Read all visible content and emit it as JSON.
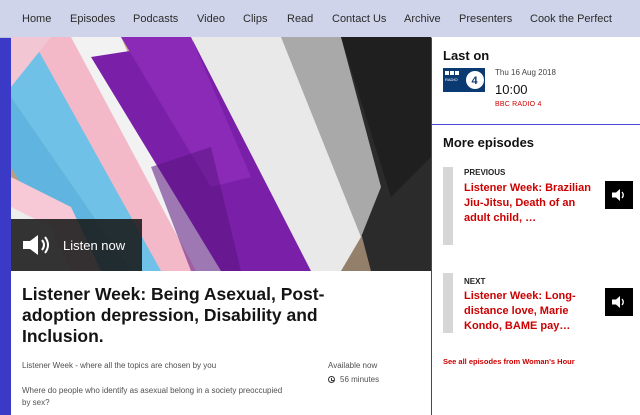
{
  "nav": {
    "items": [
      "Home",
      "Episodes",
      "Podcasts",
      "Video",
      "Clips",
      "Read",
      "Contact Us",
      "Archive",
      "Presenters",
      "Cook the Perfect"
    ]
  },
  "hero": {
    "image_description": "",
    "listen_label": "Listen now"
  },
  "episode": {
    "title": "Listener Week: Being Asexual, Post-adoption depression, Disability and Inclusion.",
    "short_synopsis": "Listener Week - where all the topics are chosen by you",
    "description": "Where do people who identify as asexual belong in a society preoccupied by sex?",
    "availability": "Available now",
    "duration": "56 minutes"
  },
  "last_on": {
    "heading": "Last on",
    "logo": "BBC RADIO 4",
    "date": "Thu 16 Aug 2018",
    "time": "10:00",
    "station": "BBC RADIO 4"
  },
  "more_episodes": {
    "heading": "More episodes",
    "previous": {
      "label": "PREVIOUS",
      "title": "Listener Week: Brazilian Jiu-Jitsu, Death of an adult child, …"
    },
    "next": {
      "label": "NEXT",
      "title": "Listener Week: Long-distance love, Marie Kondo, BAME pay…"
    },
    "all_link": "See all episodes from Woman's Hour"
  },
  "colors": {
    "nav_bg": "#cfd4ea",
    "page_bg": "#3a3ac6",
    "accent_red": "#cc0000"
  }
}
